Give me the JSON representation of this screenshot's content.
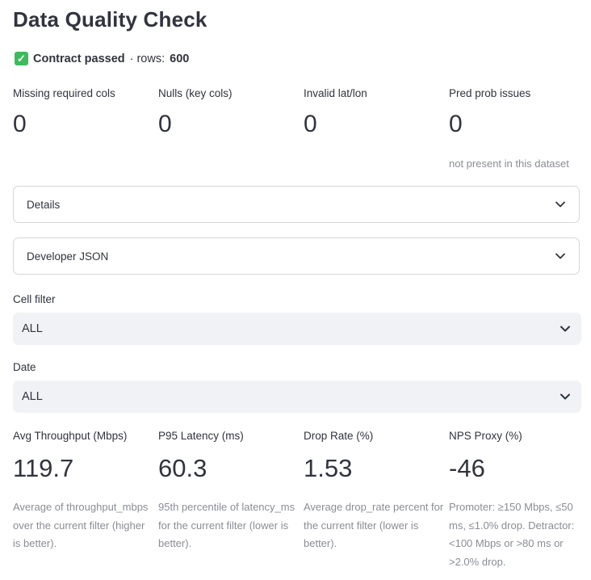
{
  "page": {
    "title": "Data Quality Check"
  },
  "status": {
    "icon": "check-mark-icon",
    "passed_text": "Contract passed",
    "separator": "· rows:",
    "rows": "600"
  },
  "quality_metrics": [
    {
      "label": "Missing required cols",
      "value": "0",
      "help": ""
    },
    {
      "label": "Nulls (key cols)",
      "value": "0",
      "help": ""
    },
    {
      "label": "Invalid lat/lon",
      "value": "0",
      "help": ""
    },
    {
      "label": "Pred prob issues",
      "value": "0",
      "help": "not present in this dataset"
    }
  ],
  "expanders": {
    "details": {
      "label": "Details",
      "icon": "chevron-down-icon"
    },
    "developer_json": {
      "label": "Developer JSON",
      "icon": "chevron-down-icon"
    }
  },
  "filters": {
    "cell": {
      "label": "Cell filter",
      "selected": "ALL",
      "icon": "chevron-down-icon"
    },
    "date": {
      "label": "Date",
      "selected": "ALL",
      "icon": "chevron-down-icon"
    }
  },
  "kpis": [
    {
      "label": "Avg Throughput (Mbps)",
      "value": "119.7",
      "help": "Average of throughput_mbps over the current filter (higher is better)."
    },
    {
      "label": "P95 Latency (ms)",
      "value": "60.3",
      "help": "95th percentile of latency_ms for the current filter (lower is better)."
    },
    {
      "label": "Drop Rate (%)",
      "value": "1.53",
      "help": "Average drop_rate percent for the current filter (lower is better)."
    },
    {
      "label": "NPS Proxy (%)",
      "value": "-46",
      "help": "Promoter: ≥150 Mbps, ≤50 ms, ≤1.0% drop. Detractor: <100 Mbps or >80 ms or >2.0% drop."
    }
  ],
  "colors": {
    "text": "#31333f",
    "muted": "#8b8d96",
    "success": "#3dbb5c",
    "select_bg": "#f0f2f6",
    "border": "#d6d6dc"
  }
}
